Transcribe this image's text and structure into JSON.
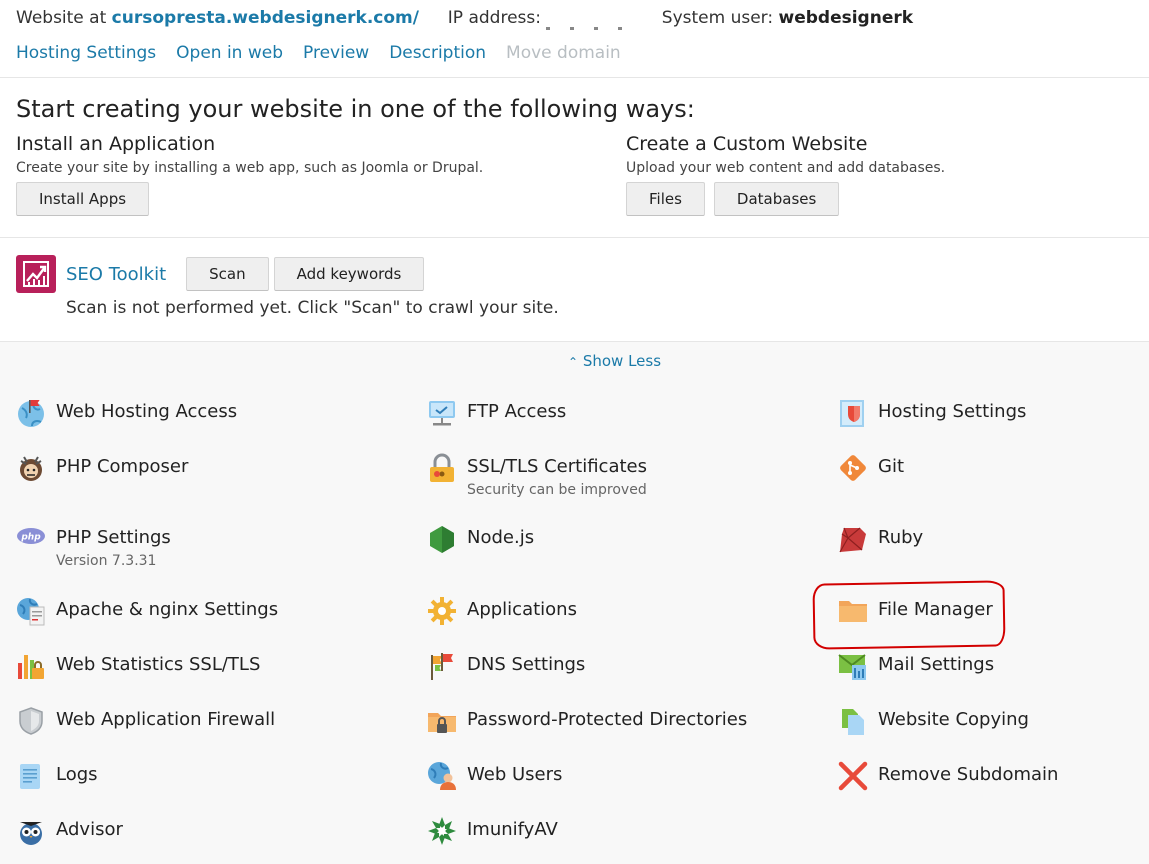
{
  "header": {
    "website_label": "Website at",
    "website_domain": "cursopresta.webdesignerk.com/",
    "ip_label": "IP address:",
    "system_user_label": "System user:",
    "system_user": "webdesignerk"
  },
  "nav": [
    {
      "label": "Hosting Settings",
      "enabled": true
    },
    {
      "label": "Open in web",
      "enabled": true
    },
    {
      "label": "Preview",
      "enabled": true
    },
    {
      "label": "Description",
      "enabled": true
    },
    {
      "label": "Move domain",
      "enabled": false
    }
  ],
  "start": {
    "title": "Start creating your website in one of the following ways:",
    "install": {
      "title": "Install an Application",
      "desc": "Create your site by installing a web app, such as Joomla or Drupal.",
      "button": "Install Apps"
    },
    "custom": {
      "title": "Create a Custom Website",
      "desc": "Upload your web content and add databases.",
      "files_button": "Files",
      "databases_button": "Databases"
    }
  },
  "seo": {
    "title": "SEO Toolkit",
    "scan_button": "Scan",
    "keywords_button": "Add keywords",
    "status": "Scan is not performed yet. Click \"Scan\" to crawl your site."
  },
  "show_less": "Show Less",
  "tiles": {
    "web_hosting_access": {
      "name": "Web Hosting Access",
      "icon": "globe-flag-icon"
    },
    "ftp_access": {
      "name": "FTP Access",
      "icon": "ftp-monitor-icon"
    },
    "hosting_settings": {
      "name": "Hosting Settings",
      "icon": "hosting-settings-icon"
    },
    "php_composer": {
      "name": "PHP Composer",
      "icon": "composer-icon"
    },
    "ssl_tls": {
      "name": "SSL/TLS Certificates",
      "sub": "Security can be improved",
      "icon": "padlock-icon"
    },
    "git": {
      "name": "Git",
      "icon": "git-icon"
    },
    "php_settings": {
      "name": "PHP Settings",
      "sub": "Version 7.3.31",
      "icon": "php-icon"
    },
    "nodejs": {
      "name": "Node.js",
      "icon": "nodejs-icon"
    },
    "ruby": {
      "name": "Ruby",
      "icon": "ruby-icon"
    },
    "apache_nginx": {
      "name": "Apache & nginx Settings",
      "icon": "apache-settings-icon"
    },
    "applications": {
      "name": "Applications",
      "icon": "gear-icon"
    },
    "file_manager": {
      "name": "File Manager",
      "icon": "folder-icon"
    },
    "web_statistics": {
      "name": "Web Statistics SSL/TLS",
      "icon": "statistics-icon"
    },
    "dns_settings": {
      "name": "DNS Settings",
      "icon": "dns-flags-icon"
    },
    "mail_settings": {
      "name": "Mail Settings",
      "icon": "mail-icon"
    },
    "waf": {
      "name": "Web Application Firewall",
      "icon": "shield-icon"
    },
    "password_dirs": {
      "name": "Password-Protected Directories",
      "icon": "locked-folder-icon"
    },
    "website_copying": {
      "name": "Website Copying",
      "icon": "copy-icon"
    },
    "logs": {
      "name": "Logs",
      "icon": "logs-icon"
    },
    "web_users": {
      "name": "Web Users",
      "icon": "web-users-icon"
    },
    "remove_subdomain": {
      "name": "Remove Subdomain",
      "icon": "remove-x-icon"
    },
    "advisor": {
      "name": "Advisor",
      "icon": "owl-icon"
    },
    "imunifyav": {
      "name": "ImunifyAV",
      "icon": "imunify-icon"
    }
  },
  "colors": {
    "link": "#1b7aa8",
    "disabled_link": "#b8bec2",
    "seo_brand": "#b8205a",
    "highlight": "#d20000"
  }
}
